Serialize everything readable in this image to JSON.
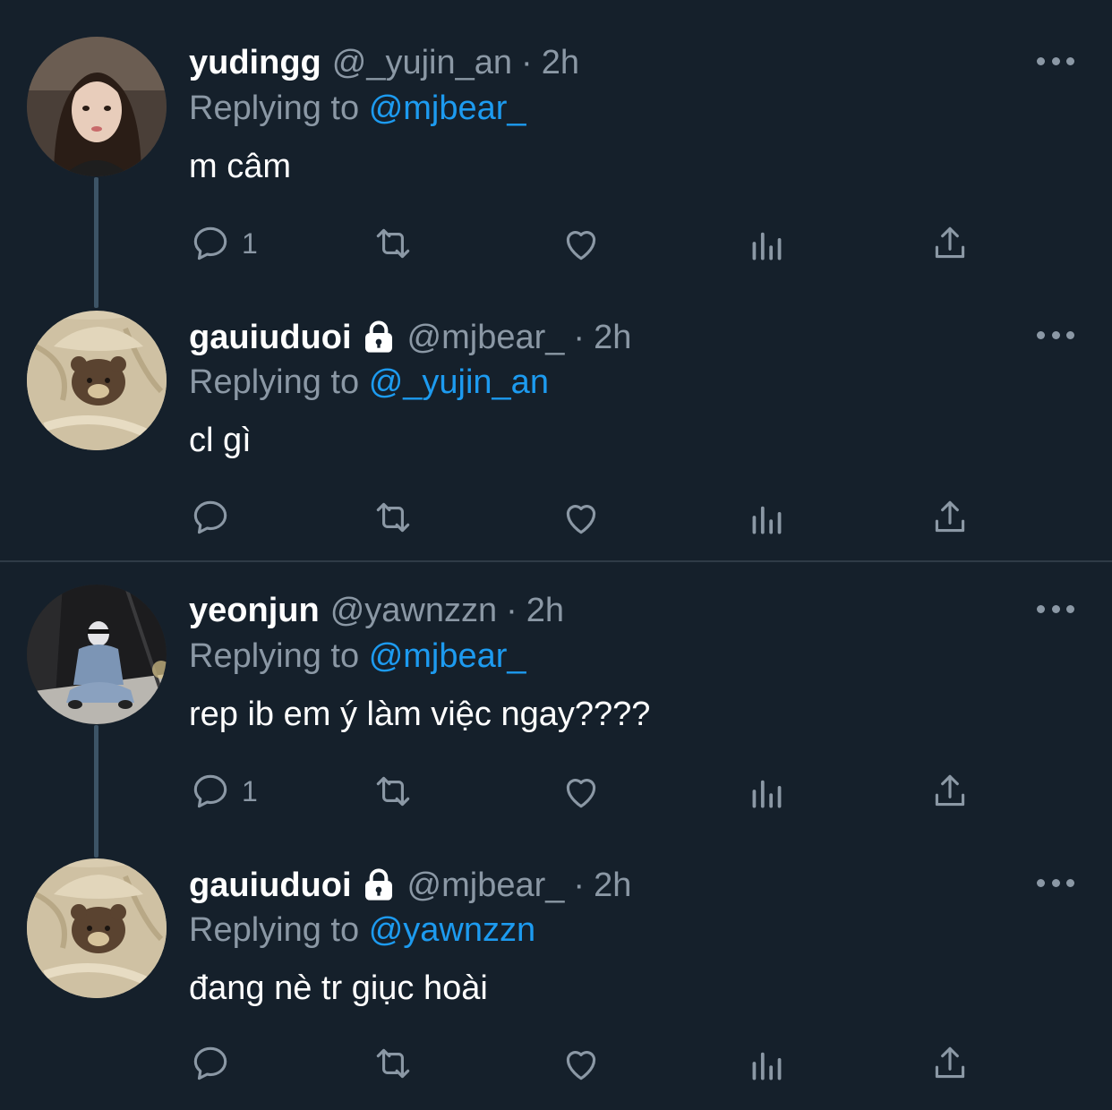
{
  "colors": {
    "background": "#15202b",
    "text": "#ffffff",
    "secondary": "#8b98a5",
    "accent": "#1d9bf0",
    "connector": "#3d5466"
  },
  "tweets": [
    {
      "display_name": "yudingg",
      "handle": "@_yujin_an",
      "separator": "·",
      "time": "2h",
      "replying_prefix": "Replying to",
      "replying_to": "@mjbear_",
      "text": "m câm",
      "reply_count": "1",
      "locked": false,
      "avatar": "girl-selfie-photo"
    },
    {
      "display_name": "gauiuduoi",
      "handle": "@mjbear_",
      "separator": "·",
      "time": "2h",
      "replying_prefix": "Replying to",
      "replying_to": "@_yujin_an",
      "text": "cl gì",
      "reply_count": "",
      "locked": true,
      "avatar": "teddy-bear-in-blanket-photo"
    },
    {
      "display_name": "yeonjun",
      "handle": "@yawnzzn",
      "separator": "·",
      "time": "2h",
      "replying_prefix": "Replying to",
      "replying_to": "@mjbear_",
      "text": "rep ib em ý làm việc ngay????",
      "reply_count": "1",
      "locked": false,
      "avatar": "person-sitting-denim-photo"
    },
    {
      "display_name": "gauiuduoi",
      "handle": "@mjbear_",
      "separator": "·",
      "time": "2h",
      "replying_prefix": "Replying to",
      "replying_to": "@yawnzzn",
      "text": "đang nè tr giục hoài",
      "reply_count": "",
      "locked": true,
      "avatar": "teddy-bear-in-blanket-photo"
    }
  ],
  "icons": {
    "reply": "reply-bubble-icon",
    "retweet": "retweet-icon",
    "like": "heart-icon",
    "analytics": "analytics-bars-icon",
    "share": "share-upload-icon",
    "more": "more-dots-icon",
    "lock": "lock-icon"
  }
}
